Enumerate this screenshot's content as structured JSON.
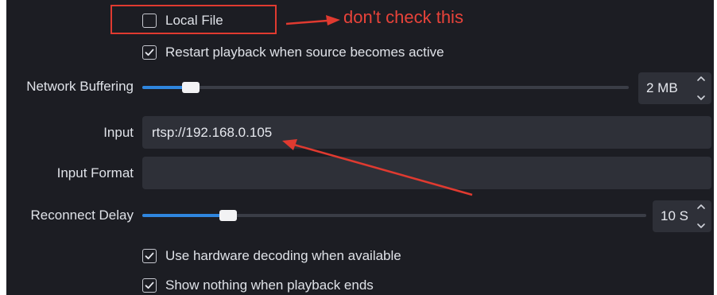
{
  "local_file": {
    "label": "Local File",
    "checked": false
  },
  "restart_playback": {
    "label": "Restart playback when source becomes active",
    "checked": true
  },
  "network_buffering": {
    "label": "Network Buffering",
    "value": "2 MB",
    "slider_fraction": 0.1
  },
  "input": {
    "label": "Input",
    "value": "rtsp://192.168.0.105"
  },
  "input_format": {
    "label": "Input Format",
    "value": ""
  },
  "reconnect_delay": {
    "label": "Reconnect Delay",
    "value": "10 S",
    "slider_fraction": 0.17
  },
  "hardware_decoding": {
    "label": "Use hardware decoding when available",
    "checked": true
  },
  "show_nothing": {
    "label": "Show nothing when playback ends",
    "checked": true
  },
  "annotation": {
    "text": "don't check this",
    "color": "#e8433a"
  },
  "colors": {
    "accent": "#2f86de",
    "panel_bg": "#1c1d23",
    "field_bg": "#2e3038",
    "annotation_red": "#e03a30"
  }
}
